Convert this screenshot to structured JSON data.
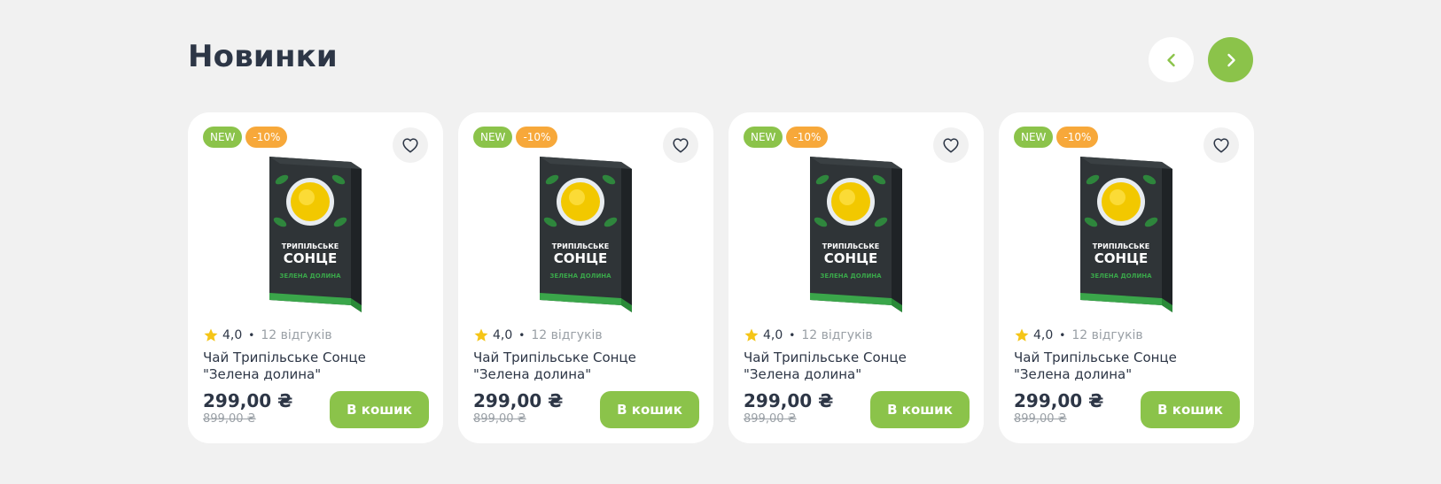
{
  "section": {
    "title": "Новинки"
  },
  "colors": {
    "accent": "#8bc34a",
    "sale_badge": "#f7a83a",
    "text": "#2d3646",
    "muted": "#9aa0a6",
    "background": "#f1f1f1"
  },
  "icons": {
    "prev": "chevron-left-icon",
    "next": "chevron-right-icon",
    "favorite": "heart-outline-icon",
    "rating": "star-icon"
  },
  "products": [
    {
      "badge_new": "NEW",
      "badge_discount": "-10%",
      "rating": "4,0",
      "separator": "•",
      "reviews": "12 відгуків",
      "name": "Чай Трипільське Сонце \"Зелена долина\"",
      "price": "299,00 ₴",
      "old_price": "899,00 ₴",
      "cart_label": "В кошик",
      "package_brand_top": "ТРИПІЛЬСЬКЕ",
      "package_brand_main": "СОНЦЕ",
      "package_variant": "ЗЕЛЕНА ДОЛИНА"
    },
    {
      "badge_new": "NEW",
      "badge_discount": "-10%",
      "rating": "4,0",
      "separator": "•",
      "reviews": "12 відгуків",
      "name": "Чай Трипільське Сонце \"Зелена долина\"",
      "price": "299,00 ₴",
      "old_price": "899,00 ₴",
      "cart_label": "В кошик",
      "package_brand_top": "ТРИПІЛЬСЬКЕ",
      "package_brand_main": "СОНЦЕ",
      "package_variant": "ЗЕЛЕНА ДОЛИНА"
    },
    {
      "badge_new": "NEW",
      "badge_discount": "-10%",
      "rating": "4,0",
      "separator": "•",
      "reviews": "12 відгуків",
      "name": "Чай Трипільське Сонце \"Зелена долина\"",
      "price": "299,00 ₴",
      "old_price": "899,00 ₴",
      "cart_label": "В кошик",
      "package_brand_top": "ТРИПІЛЬСЬКЕ",
      "package_brand_main": "СОНЦЕ",
      "package_variant": "ЗЕЛЕНА ДОЛИНА"
    },
    {
      "badge_new": "NEW",
      "badge_discount": "-10%",
      "rating": "4,0",
      "separator": "•",
      "reviews": "12 відгуків",
      "name": "Чай Трипільське Сонце \"Зелена долина\"",
      "price": "299,00 ₴",
      "old_price": "899,00 ₴",
      "cart_label": "В кошик",
      "package_brand_top": "ТРИПІЛЬСЬКЕ",
      "package_brand_main": "СОНЦЕ",
      "package_variant": "ЗЕЛЕНА ДОЛИНА"
    }
  ]
}
